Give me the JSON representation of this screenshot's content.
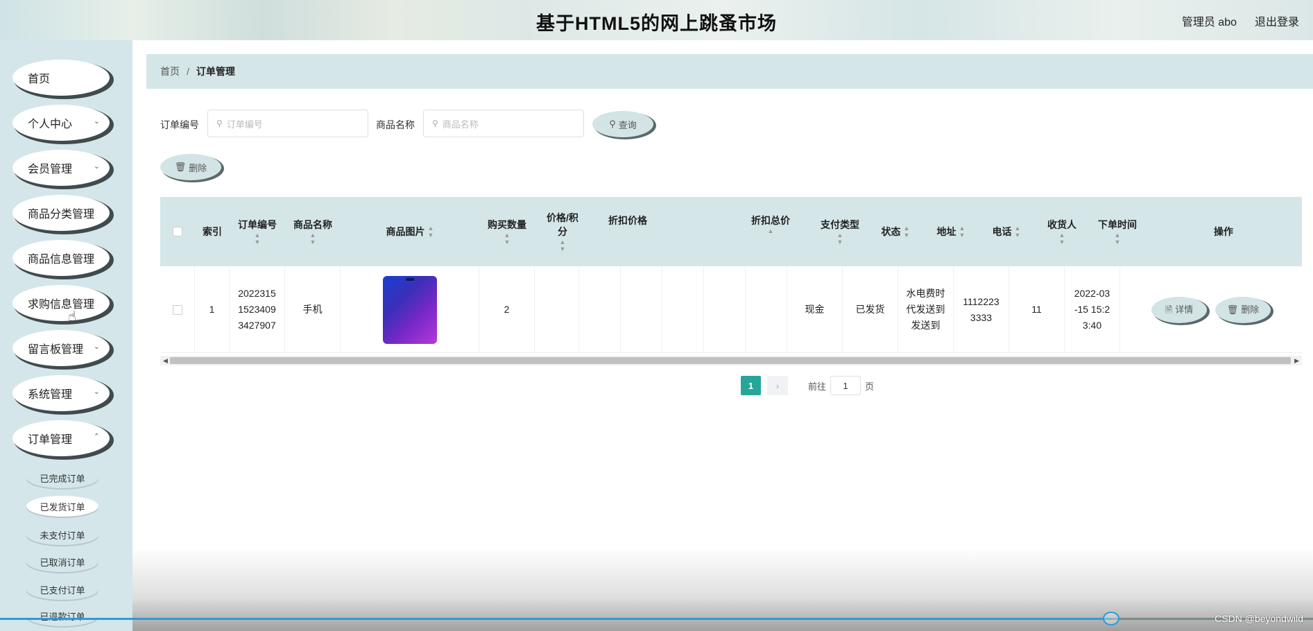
{
  "header": {
    "title": "基于HTML5的网上跳蚤市场",
    "user": "管理员 abo",
    "logout": "退出登录"
  },
  "sidebar": {
    "items": [
      {
        "label": "首页",
        "chevron": false
      },
      {
        "label": "个人中心",
        "chevron": true
      },
      {
        "label": "会员管理",
        "chevron": true
      },
      {
        "label": "商品分类管理",
        "chevron": true
      },
      {
        "label": "商品信息管理",
        "chevron": true
      },
      {
        "label": "求购信息管理",
        "chevron": true
      },
      {
        "label": "留言板管理",
        "chevron": true
      },
      {
        "label": "系统管理",
        "chevron": true
      },
      {
        "label": "订单管理",
        "chevron": true
      }
    ],
    "sub_items": [
      "已完成订单",
      "已发货订单",
      "未支付订单",
      "已取消订单",
      "已支付订单",
      "已退款订单"
    ],
    "active_sub": "已发货订单"
  },
  "breadcrumb": {
    "home": "首页",
    "separator": "/",
    "current": "订单管理"
  },
  "search": {
    "order_no_label": "订单编号",
    "order_no_placeholder": "订单编号",
    "product_label": "商品名称",
    "product_placeholder": "商品名称",
    "query_button": "查询"
  },
  "toolbar": {
    "delete_button": "删除"
  },
  "table": {
    "headers": {
      "index": "索引",
      "order_no": "订单编号",
      "product_name": "商品名称",
      "product_image": "商品图片",
      "quantity": "购买数量",
      "price": "价格/积分",
      "discount_price": "折扣价格",
      "discount_total": "折扣总价",
      "pay_type": "支付类型",
      "status": "状态",
      "address": "地址",
      "phone": "电话",
      "receiver": "收货人",
      "order_time": "下单时间",
      "actions": "操作"
    },
    "rows": [
      {
        "index": "1",
        "order_no": "20223151523409 3427907",
        "product_name": "手机",
        "quantity": "2",
        "pay_type": "现金",
        "status": "已发货",
        "address": "水电费时代发送到发送到",
        "phone": "11122233333",
        "receiver": "11",
        "order_time": "2022-03-15 15:23:40",
        "detail_button": "详情",
        "delete_button": "删除"
      }
    ]
  },
  "pagination": {
    "current": "1",
    "goto_label": "前往",
    "goto_value": "1",
    "page_suffix": "页"
  },
  "watermark": "CSDN @beyondwild"
}
